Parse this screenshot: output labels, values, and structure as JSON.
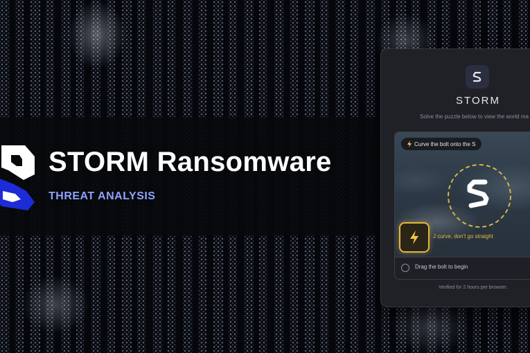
{
  "banner": {
    "title": "STORM Ransomware",
    "subtitle": "THREAT ANALYSIS",
    "logo_icon": "storm-s-logo-icon"
  },
  "captcha": {
    "logo_icon": "storm-s-icon",
    "title": "STORM",
    "description": "Solve the puzzle below to view the world ma",
    "hint_icon": "lightning-bolt-icon",
    "hint": "Curve the bolt onto the S",
    "target_icon": "s-target-icon",
    "handle_icon": "lightning-bolt-icon",
    "curve_tip": "J curve, don't go straight",
    "status_text": "Drag the bolt to begin",
    "verified_note": "Verified for 2 hours per browser.",
    "colors": {
      "accent_gold": "#e2b93b",
      "card_bg": "#1f2126",
      "subtitle_blue": "#8fa2ff",
      "logo_blue": "#1c2cd6"
    }
  }
}
